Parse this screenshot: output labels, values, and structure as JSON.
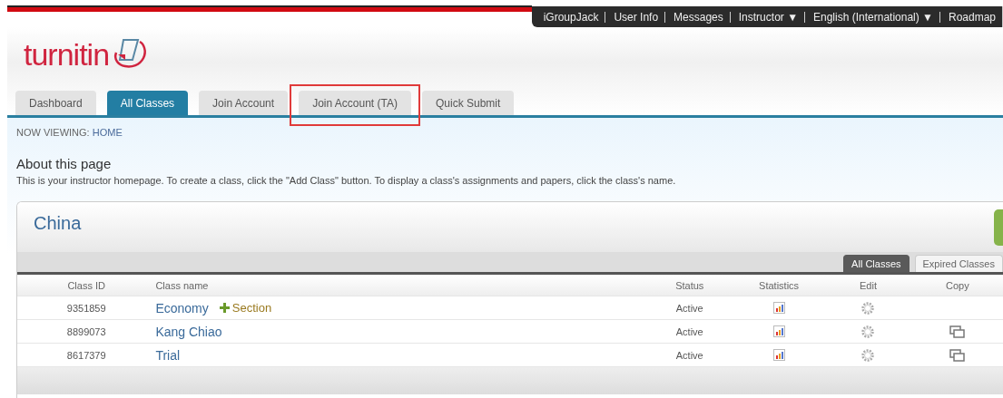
{
  "top_nav": [
    "iGroupJack",
    "User Info",
    "Messages",
    "Instructor ▼",
    "English (International) ▼",
    "Roadmap"
  ],
  "logo": {
    "text": "turnitin"
  },
  "tabs": [
    {
      "label": "Dashboard",
      "selected": false,
      "highlighted": false
    },
    {
      "label": "All Classes",
      "selected": true,
      "highlighted": false
    },
    {
      "label": "Join Account",
      "selected": false,
      "highlighted": false
    },
    {
      "label": "Join Account (TA)",
      "selected": false,
      "highlighted": true
    },
    {
      "label": "Quick Submit",
      "selected": false,
      "highlighted": false
    }
  ],
  "breadcrumb": {
    "label": "NOW VIEWING:",
    "current": "HOME"
  },
  "about": {
    "title": "About this page",
    "text": "This is your instructor homepage. To create a class, click the \"Add Class\" button. To display a class's assignments and papers, click the class's name."
  },
  "panel": {
    "title": "China",
    "filter_tabs": [
      {
        "label": "All Classes",
        "selected": true
      },
      {
        "label": "Expired Classes",
        "selected": false
      }
    ],
    "columns": [
      "Class ID",
      "Class name",
      "Status",
      "Statistics",
      "Edit",
      "Copy"
    ],
    "rows": [
      {
        "id": "9351859",
        "name": "Economy",
        "section": "Section",
        "status": "Active",
        "copy": false
      },
      {
        "id": "8899073",
        "name": "Kang Chiao",
        "status": "Active",
        "copy": true
      },
      {
        "id": "8617379",
        "name": "Trial",
        "status": "Active",
        "copy": true
      }
    ]
  }
}
